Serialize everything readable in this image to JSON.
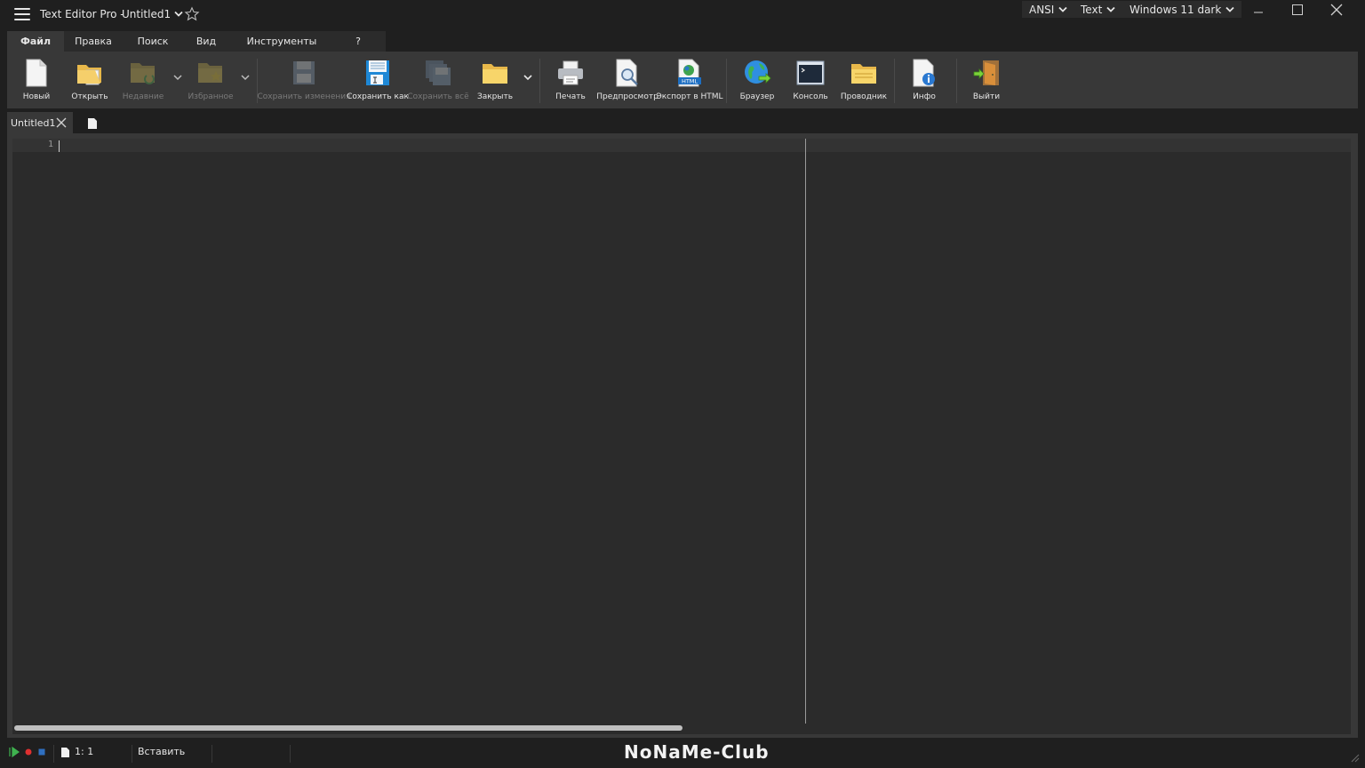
{
  "titlebar": {
    "app_name": "Text Editor Pro  -",
    "document": "Untitled1",
    "encoding": "ANSI",
    "syntax": "Text",
    "theme": "Windows 11 dark"
  },
  "menu": {
    "tabs": [
      {
        "label": "Файл",
        "active": true
      },
      {
        "label": "Правка"
      },
      {
        "label": "Поиск"
      },
      {
        "label": "Вид"
      },
      {
        "label": "Инструменты"
      },
      {
        "label": "?"
      }
    ]
  },
  "ribbon": {
    "new": "Новый",
    "open": "Открыть",
    "recent": "Недавние",
    "favorites": "Избранное",
    "save_changes": "Сохранить изменения",
    "save_as": "Сохранить как",
    "save_all": "Сохранить всё",
    "close": "Закрыть",
    "print": "Печать",
    "preview": "Предпросмотр",
    "export_html": "Экспорт в HTML",
    "browser": "Браузер",
    "console": "Консоль",
    "explorer": "Проводник",
    "info": "Инфо",
    "exit": "Выйти",
    "html_badge": "HTML"
  },
  "tabs": {
    "open_document": "Untitled1"
  },
  "editor": {
    "line_number": "1"
  },
  "status": {
    "position": "1: 1",
    "mode": "Вставить",
    "watermark": "NoNaMe-Club"
  }
}
